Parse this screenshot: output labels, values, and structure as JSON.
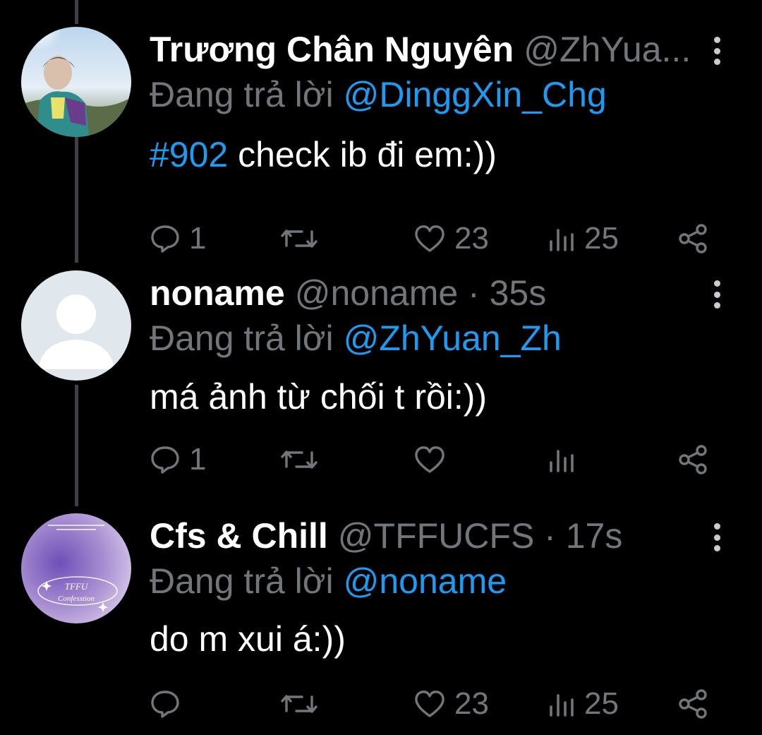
{
  "tweets": [
    {
      "name": "Trương Chân Nguyên",
      "handle": "@ZhYua...",
      "reply_prefix": "Đang trả lời",
      "reply_to": "@DinggXin_Chg",
      "hashtag": "#902",
      "text": " check ib đi em:))",
      "reply_count": "1",
      "retweet_count": "",
      "like_count": "23",
      "view_count": "25"
    },
    {
      "name": "noname",
      "handle": "@noname · 35s",
      "reply_prefix": "Đang trả lời",
      "reply_to": "@ZhYuan_Zh",
      "hashtag": "",
      "text": "má ảnh từ chối t rồi:))",
      "reply_count": "1",
      "retweet_count": "",
      "like_count": "",
      "view_count": ""
    },
    {
      "name": "Cfs & Chill",
      "handle": "@TFFUCFS · 17s",
      "reply_prefix": "Đang trả lời",
      "reply_to": "@noname",
      "hashtag": "",
      "text": "do m xui á:))",
      "reply_count": "",
      "retweet_count": "",
      "like_count": "23",
      "view_count": "25",
      "avatar_text": "TFFU Confesstion"
    }
  ],
  "colors": {
    "background": "#000000",
    "accent": "#1d9bf0",
    "secondary_text": "#71767b"
  },
  "icons": [
    "reply-icon",
    "retweet-icon",
    "like-icon",
    "views-icon",
    "share-icon",
    "more-icon"
  ]
}
